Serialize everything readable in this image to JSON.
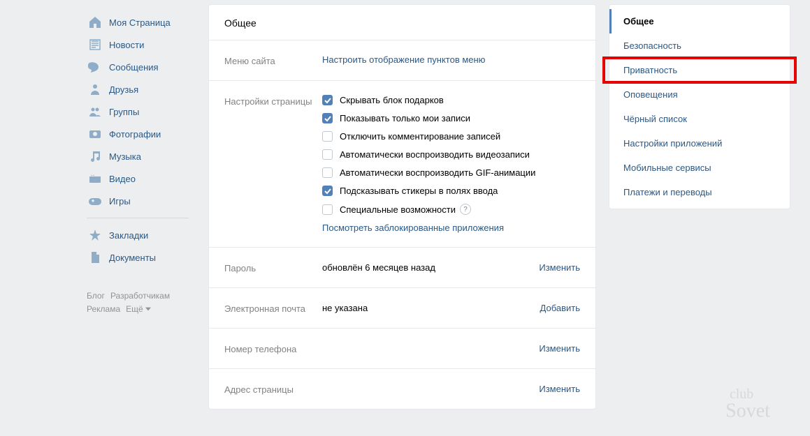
{
  "nav": {
    "items": [
      {
        "label": "Моя Страница",
        "icon": "home"
      },
      {
        "label": "Новости",
        "icon": "news"
      },
      {
        "label": "Сообщения",
        "icon": "messages"
      },
      {
        "label": "Друзья",
        "icon": "friends"
      },
      {
        "label": "Группы",
        "icon": "groups"
      },
      {
        "label": "Фотографии",
        "icon": "photos"
      },
      {
        "label": "Музыка",
        "icon": "music"
      },
      {
        "label": "Видео",
        "icon": "video"
      },
      {
        "label": "Игры",
        "icon": "games"
      },
      {
        "label": "Закладки",
        "icon": "bookmarks"
      },
      {
        "label": "Документы",
        "icon": "documents"
      }
    ]
  },
  "footer": {
    "blog": "Блог",
    "dev": "Разработчикам",
    "ads": "Реклама",
    "more": "Ещё"
  },
  "page_title": "Общее",
  "sections": {
    "site_menu": {
      "label": "Меню сайта",
      "link": "Настроить отображение пунктов меню"
    },
    "page_settings": {
      "label": "Настройки страницы",
      "checks": [
        {
          "checked": true,
          "text": "Скрывать блок подарков"
        },
        {
          "checked": true,
          "text": "Показывать только мои записи"
        },
        {
          "checked": false,
          "text": "Отключить комментирование записей"
        },
        {
          "checked": false,
          "text": "Автоматически воспроизводить видеозаписи"
        },
        {
          "checked": false,
          "text": "Автоматически воспроизводить GIF-анимации"
        },
        {
          "checked": true,
          "text": "Подсказывать стикеры в полях ввода"
        },
        {
          "checked": false,
          "text": "Специальные возможности",
          "help": true
        }
      ],
      "blocked_link": "Посмотреть заблокированные приложения"
    },
    "password": {
      "label": "Пароль",
      "value": "обновлён 6 месяцев назад",
      "action": "Изменить"
    },
    "email": {
      "label": "Электронная почта",
      "value": "не указана",
      "action": "Добавить"
    },
    "phone": {
      "label": "Номер телефона",
      "value": "",
      "action": "Изменить"
    },
    "address": {
      "label": "Адрес страницы",
      "value": "",
      "action": "Изменить"
    }
  },
  "right_nav": {
    "items": [
      {
        "label": "Общее",
        "active": true
      },
      {
        "label": "Безопасность"
      },
      {
        "label": "Приватность",
        "highlight": true
      },
      {
        "label": "Оповещения"
      },
      {
        "label": "Чёрный список"
      },
      {
        "label": "Настройки приложений"
      },
      {
        "label": "Мобильные сервисы"
      },
      {
        "label": "Платежи и переводы"
      }
    ]
  }
}
